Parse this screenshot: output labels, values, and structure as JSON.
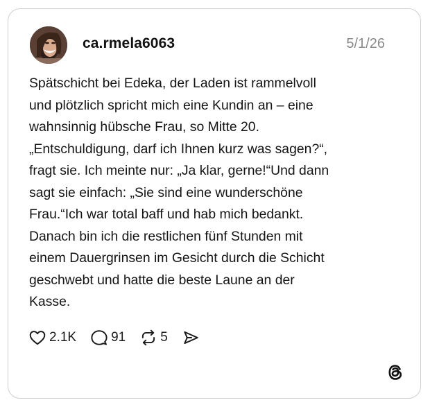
{
  "post": {
    "username": "ca.rmela6063",
    "date": "5/1/26",
    "text": "Spätschicht bei Edeka, der Laden ist rammelvoll\nund plötzlich spricht mich eine Kundin an – eine\nwahnsinnig hübsche Frau, so Mitte 20.\n„Entschuldigung, darf ich Ihnen kurz was sagen?“,\nfragt sie. Ich meinte nur: „Ja klar, gerne!“Und dann\nsagt sie einfach: „Sie sind eine wunderschöne\nFrau.“Ich war total baff und hab mich  bedankt.\nDanach bin ich die restlichen fünf Stunden mit\neinem Dauergrinsen im Gesicht durch die Schicht\ngeschwebt und hatte die beste Laune an der\nKasse."
  },
  "actions": {
    "likes": "2.1K",
    "replies": "91",
    "reposts": "5"
  },
  "icons": {
    "like": "heart-icon",
    "reply": "speech-bubble-icon",
    "repost": "repost-arrows-icon",
    "share": "paper-plane-icon",
    "logo": "threads-logo-icon"
  }
}
